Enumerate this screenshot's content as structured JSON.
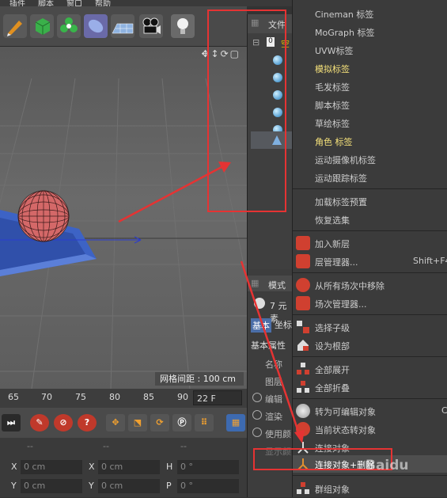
{
  "menubar": {
    "items": [
      "插件",
      "脚本",
      "窗口",
      "帮助"
    ]
  },
  "toolbar": {
    "icons": [
      "pen-icon",
      "cube-icon",
      "cloner-icon",
      "deformer-icon",
      "floor-icon",
      "camera-icon",
      "light-icon"
    ]
  },
  "viewport": {
    "grid_distance": "网格间距 : 100 cm",
    "nav_icons": "✥↕⟳▢"
  },
  "timeline": {
    "ticks": [
      "65",
      "70",
      "75",
      "80",
      "85",
      "90"
    ],
    "frame": "22 F"
  },
  "coords": {
    "rows": [
      {
        "l1": "X",
        "v1": "0 cm",
        "l2": "X",
        "v2": "0 cm",
        "l3": "H",
        "v3": "0 °"
      },
      {
        "l1": "Y",
        "v1": "0 cm",
        "l2": "Y",
        "v2": "0 cm",
        "l3": "P",
        "v3": "0 °"
      }
    ],
    "dashes": "--"
  },
  "object_manager": {
    "title": "文件",
    "root": "0",
    "root_label": "空"
  },
  "attributes": {
    "title": "模式",
    "count": "7 元素",
    "tabs": [
      "基本",
      "坐标"
    ],
    "section": "基本属性",
    "fields": [
      "名称",
      "图层",
      "编辑",
      "渲染",
      "使用颜",
      "显示颜"
    ]
  },
  "context_menu": {
    "tags": [
      "Cineman 标签",
      "MoGraph 标签",
      "UVW标签",
      "模拟标签",
      "毛发标签",
      "脚本标签",
      "草绘标签",
      "角色 标签",
      "运动摄像机标签",
      "运动跟踪标签"
    ],
    "presets": [
      "加载标签预置",
      "恢复选集"
    ],
    "layers": [
      {
        "label": "加入新层",
        "shortcut": ""
      },
      {
        "label": "层管理器...",
        "shortcut": "Shift+F4"
      }
    ],
    "scene": [
      "从所有场次中移除",
      "场次管理器..."
    ],
    "hierarchy": [
      "选择子级",
      "设为根部"
    ],
    "expand": [
      "全部展开",
      "全部折叠"
    ],
    "convert": [
      {
        "label": "转为可编辑对象",
        "shortcut": "C"
      },
      {
        "label": "当前状态转对象",
        "shortcut": ""
      },
      {
        "label": "连接对象",
        "shortcut": ""
      },
      {
        "label": "连接对象+删除",
        "shortcut": ""
      },
      {
        "label": "群组对象",
        "shortcut": ""
      }
    ]
  },
  "watermark": "Baidu",
  "colors": {
    "accent_red": "#e53333",
    "highlight_text": "#f5e17a",
    "object_name": "#e6b400"
  }
}
